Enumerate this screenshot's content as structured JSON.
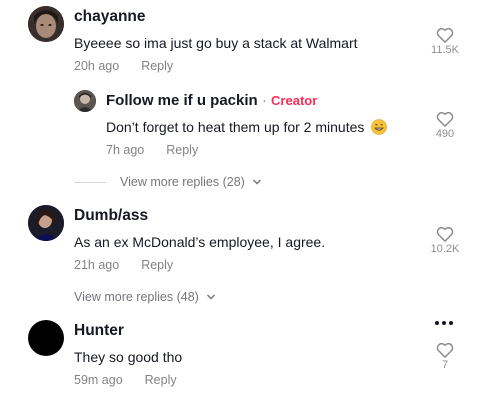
{
  "comments": [
    {
      "username": "chayanne",
      "text": "Byeeee so ima just go buy a stack at Walmart",
      "time": "20h ago",
      "reply_label": "Reply",
      "likes": "11.5K",
      "replies": [
        {
          "username": "Follow me if u packin",
          "separator": "·",
          "badge": "Creator",
          "text": "Don’t forget to heat them up for 2 minutes",
          "emoji": "grinning-face-emoji",
          "time": "7h ago",
          "reply_label": "Reply",
          "likes": "490"
        }
      ],
      "view_more": "View more replies (28)"
    },
    {
      "username": "Dumb/ass",
      "text": "As an ex McDonald’s employee, I agree.",
      "time": "21h ago",
      "reply_label": "Reply",
      "likes": "10.2K",
      "view_more": "View more replies (48)"
    },
    {
      "username": "Hunter",
      "text": "They so good tho",
      "time": "59m ago",
      "reply_label": "Reply",
      "likes": "7",
      "more_icon": "more-options-icon"
    }
  ],
  "colors": {
    "creator_badge": "#fe2c55",
    "text_primary": "#161823",
    "text_secondary": "#8a8b91"
  },
  "icons": [
    "heart-outline-icon",
    "chevron-down-icon",
    "more-options-icon"
  ]
}
